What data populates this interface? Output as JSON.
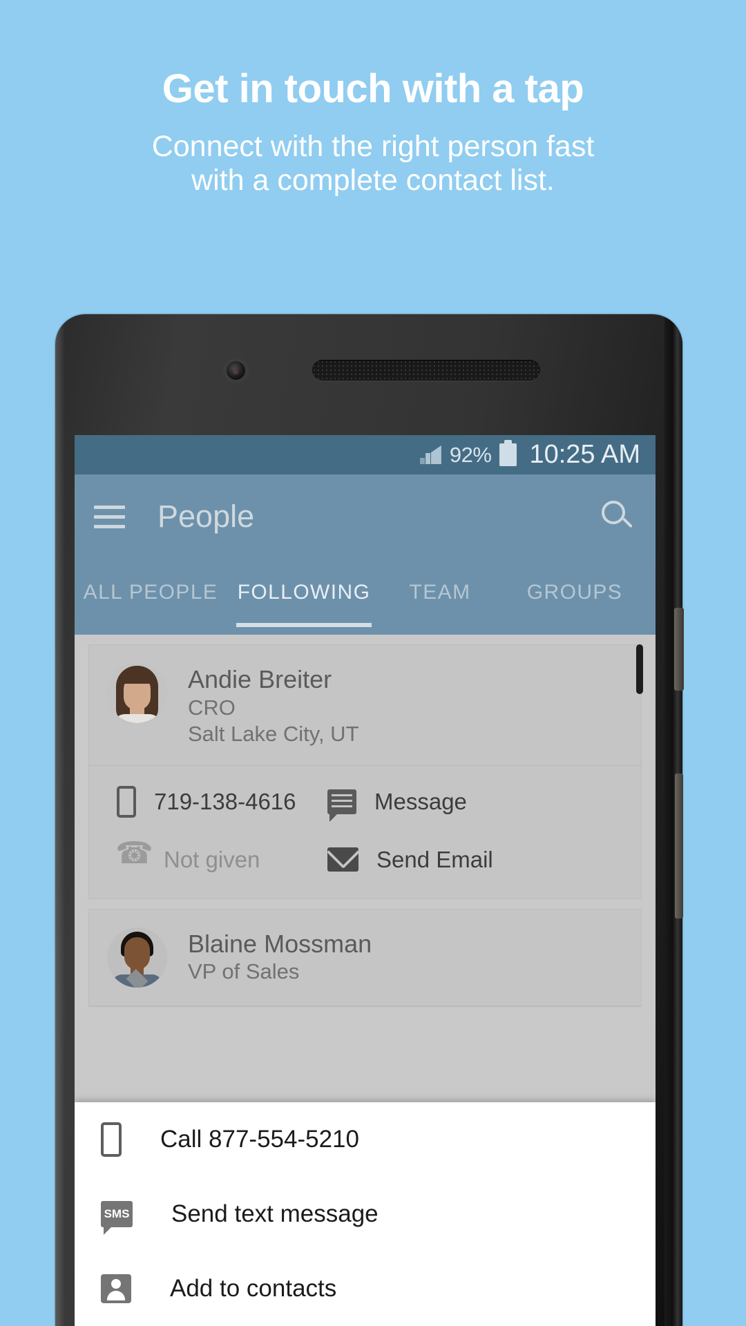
{
  "promo": {
    "title": "Get in touch with a tap",
    "subtitle_line1": "Connect with the right person fast",
    "subtitle_line2": "with a complete contact list.",
    "background_color": "#90cdf0",
    "text_color": "#ffffff"
  },
  "status_bar": {
    "battery_percent": "92%",
    "time": "10:25 AM",
    "signal_icon": "signal-bars-icon",
    "battery_icon": "battery-icon",
    "background_color": "#456c85"
  },
  "app_bar": {
    "menu_icon": "hamburger-menu-icon",
    "title": "People",
    "search_icon": "search-icon",
    "background_color": "#6d91ab"
  },
  "tabs": [
    {
      "label": "ALL PEOPLE",
      "active": false
    },
    {
      "label": "FOLLOWING",
      "active": true
    },
    {
      "label": "TEAM",
      "active": false
    },
    {
      "label": "GROUPS",
      "active": false
    }
  ],
  "contacts": [
    {
      "name": "Andie Breiter",
      "role": "CRO",
      "location": "Salt Lake City, UT",
      "avatar": "avatar-female",
      "actions": [
        {
          "icon": "mobile-phone-icon",
          "label": "719-138-4616",
          "dim": false
        },
        {
          "icon": "message-bubble-icon",
          "label": "Message",
          "dim": false
        },
        {
          "icon": "handset-phone-icon",
          "label": "Not given",
          "dim": true
        },
        {
          "icon": "envelope-icon",
          "label": "Send Email",
          "dim": false
        }
      ]
    },
    {
      "name": "Blaine Mossman",
      "role": "VP of Sales",
      "location": "",
      "avatar": "avatar-male",
      "actions": []
    }
  ],
  "bottom_sheet": {
    "items": [
      {
        "icon": "mobile-phone-icon",
        "label": "Call 877-554-5210"
      },
      {
        "icon": "sms-icon",
        "label": "Send text message"
      },
      {
        "icon": "add-contact-icon",
        "label": "Add to contacts"
      }
    ]
  }
}
